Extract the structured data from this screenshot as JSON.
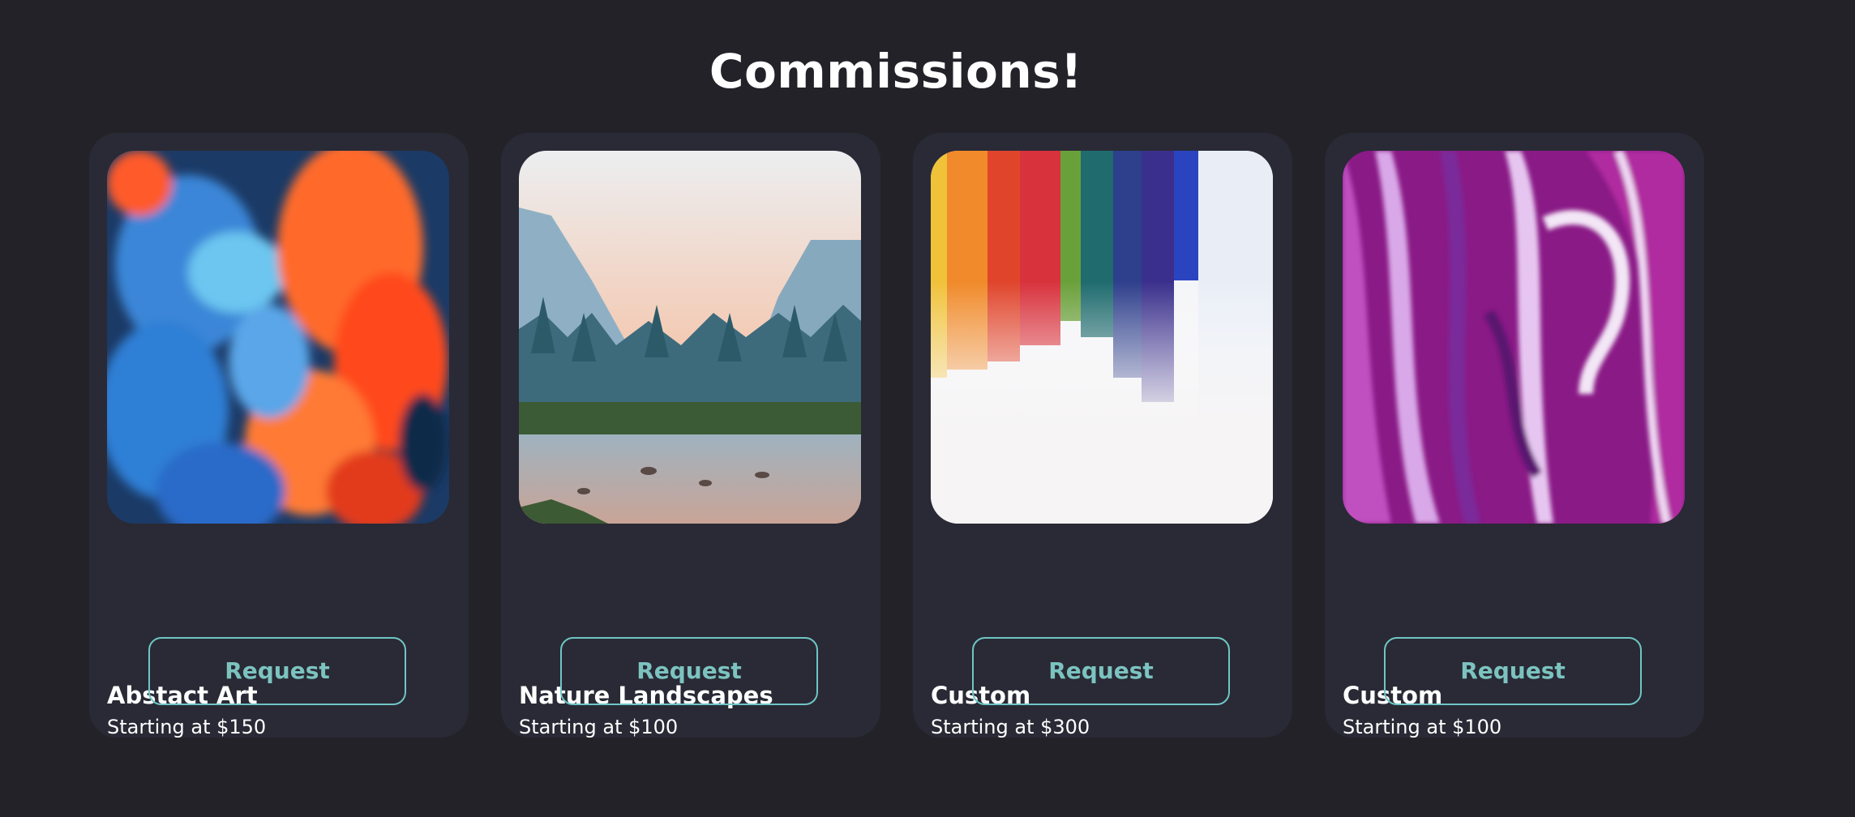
{
  "page": {
    "title": "Commissions!"
  },
  "cards": [
    {
      "name": "Abstact Art",
      "price": "Starting at $150",
      "button": "Request",
      "image": "abstract-smoke-art"
    },
    {
      "name": "Nature Landscapes",
      "price": "Starting at $100",
      "button": "Request",
      "image": "mountain-forest-landscape"
    },
    {
      "name": "Custom",
      "price": "Starting at $300",
      "button": "Request",
      "image": "rainbow-paint-strokes"
    },
    {
      "name": "Custom",
      "price": "Starting at $100",
      "button": "Request",
      "image": "purple-paint-swirl"
    }
  ],
  "colors": {
    "background": "#222228",
    "card": "#292a35",
    "accent": "#7cc3c0",
    "text": "#ffffff"
  }
}
